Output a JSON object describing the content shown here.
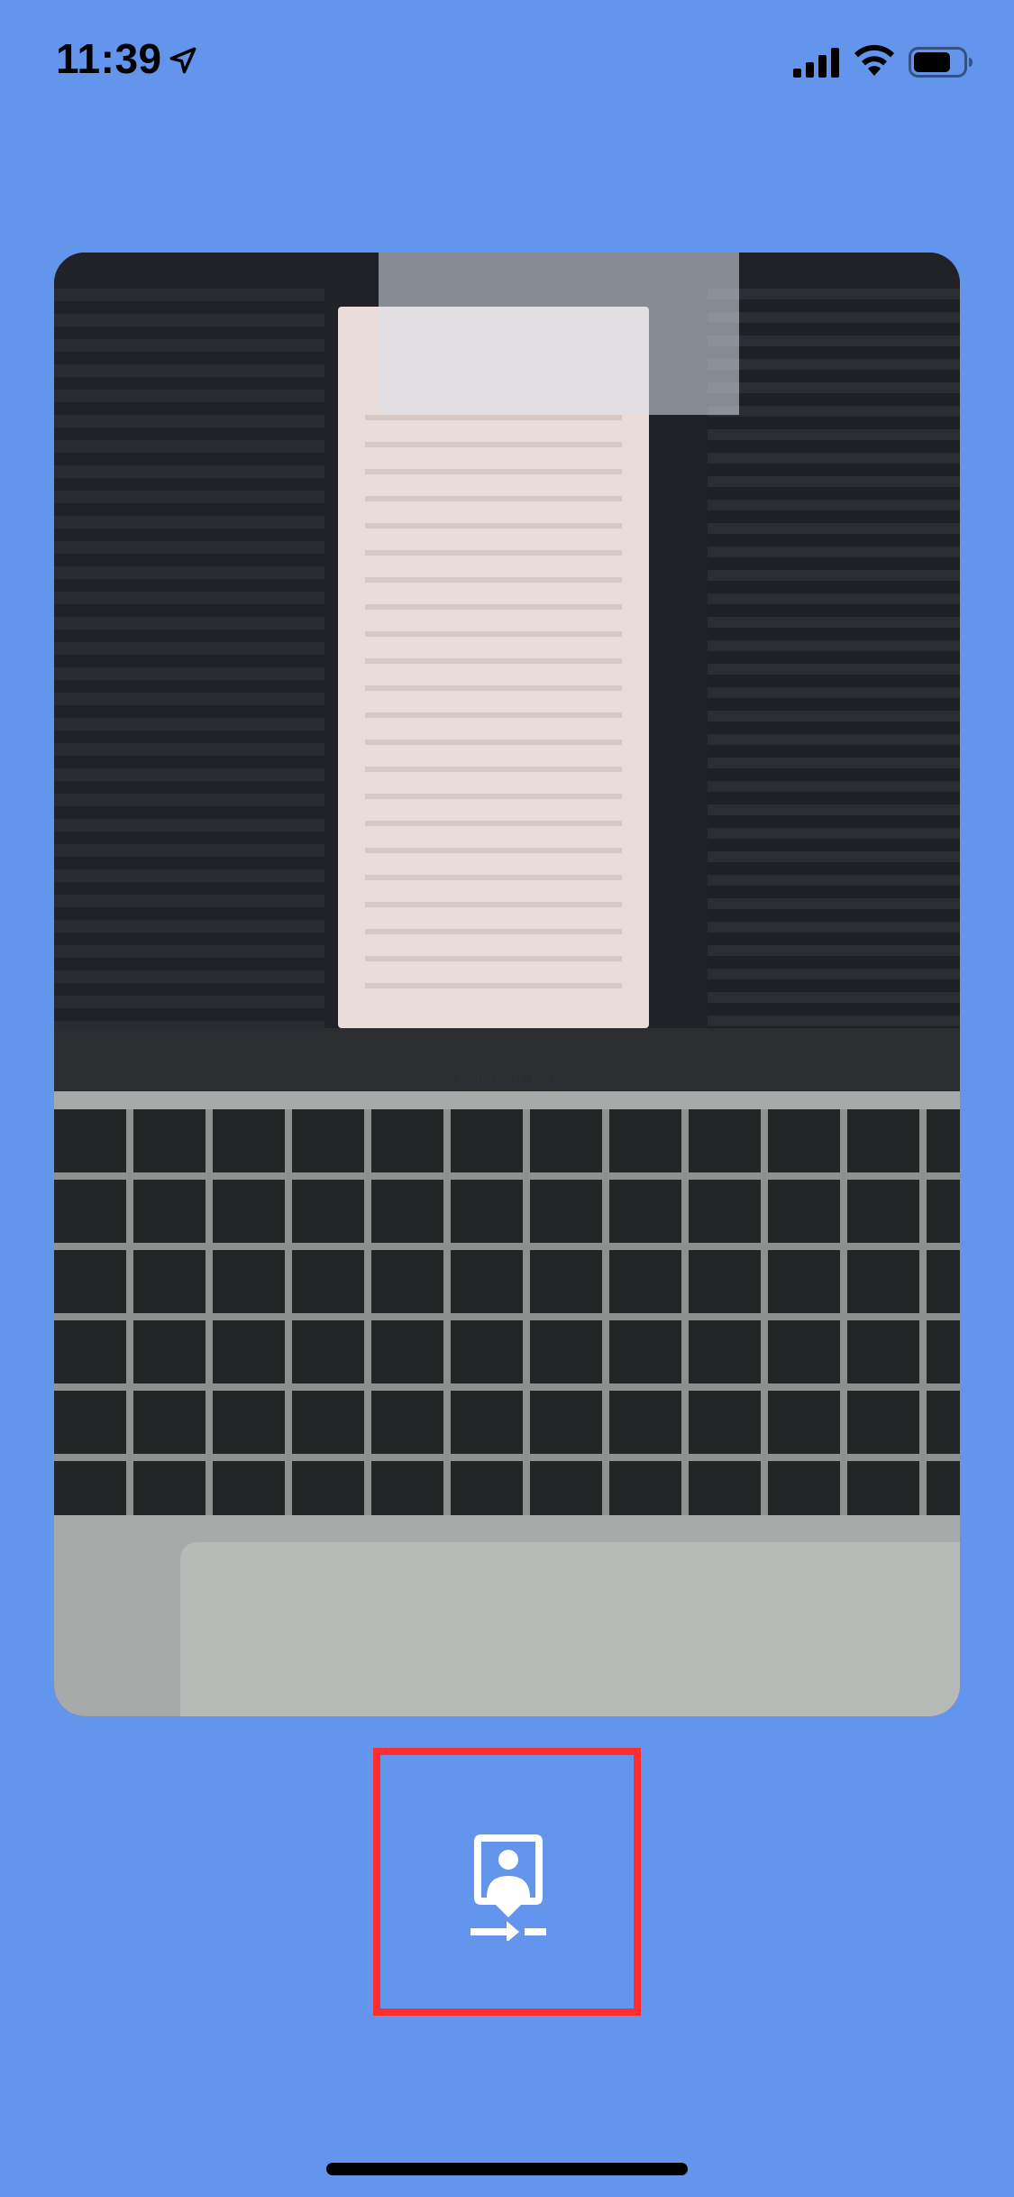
{
  "status_bar": {
    "time": "11:39",
    "icons": [
      "location-arrow-icon",
      "cellular-signal-icon",
      "wifi-icon",
      "battery-icon"
    ]
  },
  "camera_preview": {
    "image_description": "",
    "laptop_label": "MacBook Pro"
  },
  "controls": {
    "switch_camera": {
      "icon": "switch-camera-icon",
      "border_color": "#FF2D2D"
    }
  },
  "colors": {
    "background": "#6495ED",
    "highlight_border": "#FF2D2D",
    "icon_fill": "#FFFFFF"
  }
}
